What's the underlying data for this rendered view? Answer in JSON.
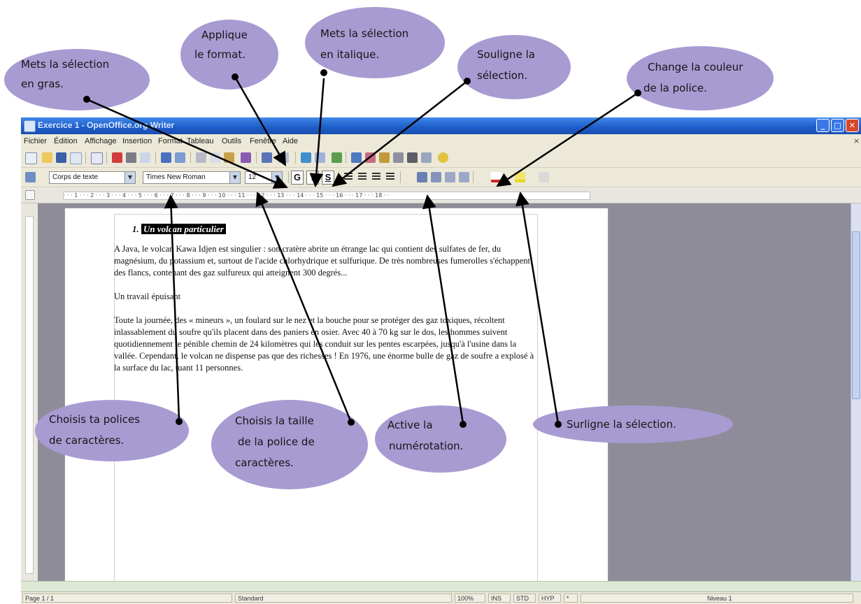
{
  "window": {
    "title": "Exercice 1 - OpenOffice.org Writer",
    "controls": {
      "minimize": "_",
      "maximize": "□",
      "close": "✕"
    }
  },
  "menu": {
    "items": [
      "Fichier",
      "Édition",
      "Affichage",
      "Insertion",
      "Format",
      "Tableau",
      "Outils",
      "Fenêtre",
      "Aide"
    ],
    "close_glyph": "×"
  },
  "formatting": {
    "paragraph_style": "Corps de texte",
    "font_name": "Times New Roman",
    "font_size": "12",
    "bold_label": "G",
    "italic_label": "I",
    "underline_label": "S",
    "dropdown_glyph": "▼"
  },
  "ruler": {
    "marks": "· · · 1 · · · 2 · · · 3 · · · 4 · · · 5 · · · 6 · · · 7 · · · 8 · · · 9 · · · 10 · · · 11 · · · 12 · · · 13 · · · 14 · · · 15 · · · 16 · · · 17 · · · 18 · ·"
  },
  "document": {
    "heading_number": "1.",
    "heading": "Un volcan particulier",
    "paragraph_1": "A Java, le volcan Kawa Idjen est singulier : son cratère abrite un étrange lac qui contient des sulfates de fer, du magnésium, du potassium et, surtout de l'acide chlorhydrique et sulfurique. De très nombreuses fumerolles s'échappent des flancs, contenant des gaz sulfureux qui atteignent 300 degrés...",
    "subheading": "Un travail épuisant",
    "paragraph_2": "Toute la journée, des « mineurs », un foulard sur le nez et la bouche pour se protéger des gaz toxiques, récoltent inlassablement du soufre qu'ils placent dans des paniers en osier. Avec 40 à 70 kg sur le dos, les hommes suivent quotidiennement le pénible chemin de 24 kilomètres qui les conduit sur les pentes escarpées, jusqu'à l'usine dans la vallée. Cependant, le volcan ne dispense pas que des richesses ! En 1976, une énorme bulle de gaz de soufre a explosé à la surface du lac, tuant 11 personnes."
  },
  "status": {
    "page": "Page 1 / 1",
    "style": "Standard",
    "zoom": "100%",
    "ins": "INS",
    "std": "STD",
    "hyp": "HYP",
    "modified": "*",
    "level": "Niveau 1"
  },
  "callouts": {
    "bold": [
      "Mets la sélection",
      "en gras."
    ],
    "apply_format": [
      "Applique",
      "le format."
    ],
    "italic": [
      "Mets la sélection",
      "en italique."
    ],
    "underline": [
      "Souligne la",
      "sélection."
    ],
    "font_color": [
      "Change la couleur",
      "de la police."
    ],
    "font_family": [
      "Choisis ta polices",
      "de caractères."
    ],
    "font_size": [
      "Choisis la taille",
      "de la police de",
      "caractères."
    ],
    "numbering": [
      "Active la",
      "numérotation."
    ],
    "highlight": [
      "Surligne la sélection."
    ]
  },
  "colors": {
    "callout_fill": "#a89bd2",
    "titlebar": "#1d5cc8",
    "document_background": "#8e8c99",
    "window_chrome": "#ece9d8"
  }
}
